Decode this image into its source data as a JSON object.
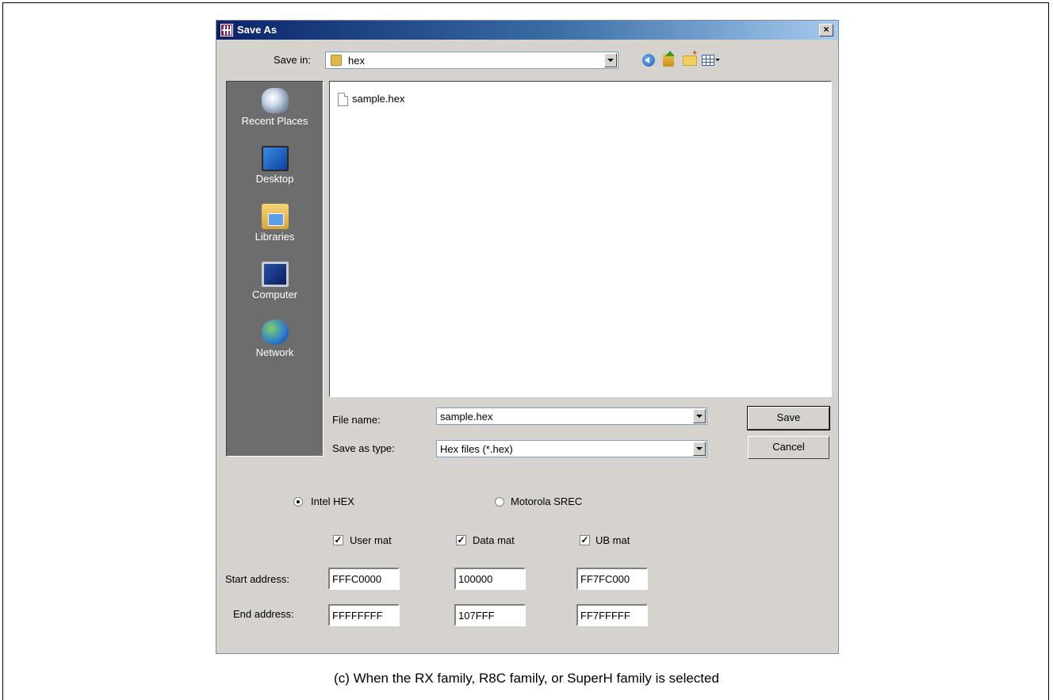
{
  "window": {
    "title": "Save As",
    "close_glyph": "×"
  },
  "save_in": {
    "label": "Save in:",
    "value": "hex"
  },
  "toolbar": {
    "icons": [
      "back-icon",
      "up-folder-icon",
      "new-folder-icon",
      "views-icon"
    ]
  },
  "places": [
    {
      "label": "Recent Places",
      "icon": "recent-places-icon"
    },
    {
      "label": "Desktop",
      "icon": "desktop-icon"
    },
    {
      "label": "Libraries",
      "icon": "libraries-icon"
    },
    {
      "label": "Computer",
      "icon": "computer-icon"
    },
    {
      "label": "Network",
      "icon": "network-icon"
    }
  ],
  "files": [
    {
      "name": "sample.hex"
    }
  ],
  "file_name": {
    "label": "File name:",
    "value": "sample.hex"
  },
  "save_as_type": {
    "label": "Save as type:",
    "value": "Hex files (*.hex)"
  },
  "buttons": {
    "save": "Save",
    "cancel": "Cancel"
  },
  "format": {
    "intel": {
      "label": "Intel HEX",
      "selected": true
    },
    "motorola": {
      "label": "Motorola SREC",
      "selected": false
    }
  },
  "mats": [
    {
      "label": "User mat",
      "checked": true,
      "start": "FFFC0000",
      "end": "FFFFFFFF"
    },
    {
      "label": "Data mat",
      "checked": true,
      "start": "100000",
      "end": "107FFF"
    },
    {
      "label": "UB mat",
      "checked": true,
      "start": "FF7FC000",
      "end": "FF7FFFFF"
    }
  ],
  "labels": {
    "start_address": "Start address:",
    "end_address": "End address:"
  },
  "caption": "(c) When the RX family, R8C family, or SuperH family is selected"
}
